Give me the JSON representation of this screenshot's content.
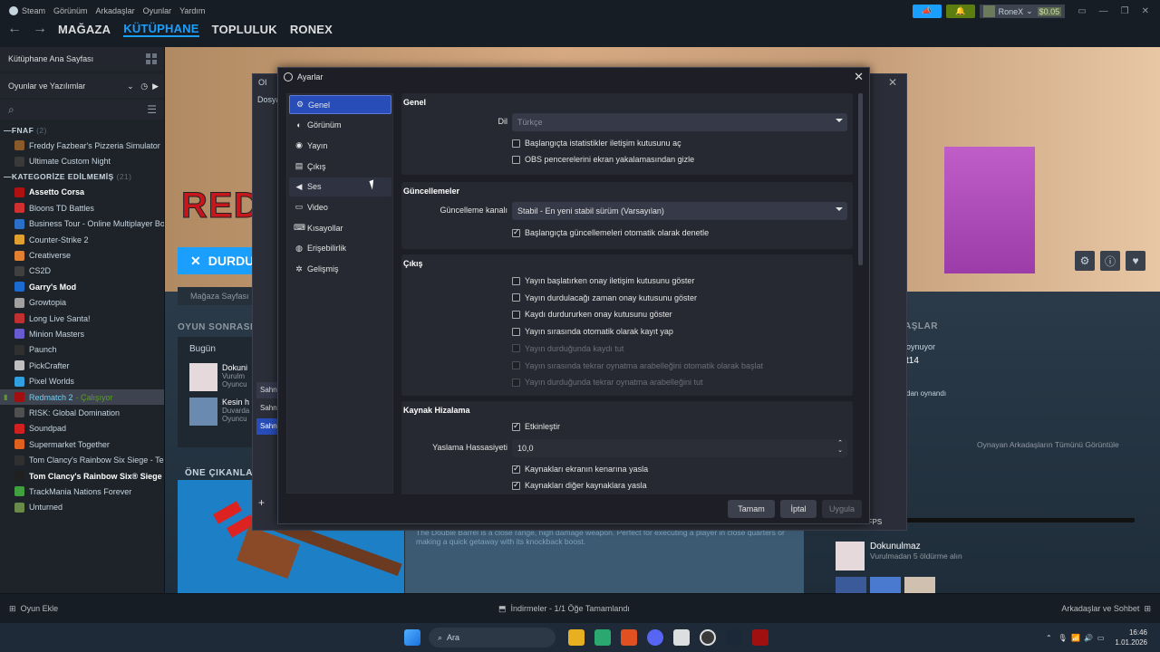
{
  "menubar": {
    "steam": "Steam",
    "items": [
      "Görünüm",
      "Arkadaşlar",
      "Oyunlar",
      "Yardım"
    ]
  },
  "nav": {
    "tabs": [
      "MAĞAZA",
      "KÜTÜPHANE",
      "TOPLULUK",
      "RONEX"
    ],
    "active": "KÜTÜPHANE"
  },
  "user": {
    "name": "RoneX",
    "balance": "$0.05"
  },
  "sidebar": {
    "home": "Kütüphane Ana Sayfası",
    "filter": "Oyunlar ve Yazılımlar",
    "sections": [
      {
        "name": "FNAF",
        "count": "(2)",
        "games": [
          {
            "label": "Freddy Fazbear's Pizzeria Simulator",
            "color": "#8a5a2a"
          },
          {
            "label": "Ultimate Custom Night",
            "color": "#3a3a3a"
          }
        ]
      },
      {
        "name": "KATEGORİZE EDİLMEMİŞ",
        "count": "(21)",
        "games": [
          {
            "label": "Assetto Corsa",
            "color": "#b01010",
            "bold": true
          },
          {
            "label": "Bloons TD Battles",
            "color": "#d03030"
          },
          {
            "label": "Business Tour - Online Multiplayer Bo",
            "color": "#2a70c8"
          },
          {
            "label": "Counter-Strike 2",
            "color": "#e0a030"
          },
          {
            "label": "Creativerse",
            "color": "#e08030"
          },
          {
            "label": "CS2D",
            "color": "#404040"
          },
          {
            "label": "Garry's Mod",
            "color": "#1a6ad0",
            "bold": true
          },
          {
            "label": "Growtopia",
            "color": "#a0a0a0"
          },
          {
            "label": "Long Live Santa!",
            "color": "#c03030"
          },
          {
            "label": "Minion Masters",
            "color": "#6a5ad0"
          },
          {
            "label": "Paunch",
            "color": "#303030"
          },
          {
            "label": "PickCrafter",
            "color": "#c0c0c0"
          },
          {
            "label": "Pixel Worlds",
            "color": "#30a0e0"
          },
          {
            "label": "Redmatch 2",
            "color": "#a01010",
            "running": true,
            "status": "- Çalışıyor"
          },
          {
            "label": "RISK: Global Domination",
            "color": "#505050"
          },
          {
            "label": "Soundpad",
            "color": "#d02020"
          },
          {
            "label": "Supermarket Together",
            "color": "#e06020"
          },
          {
            "label": "Tom Clancy's Rainbow Six Siege - Tes",
            "color": "#303030"
          },
          {
            "label": "Tom Clancy's Rainbow Six® Siege X",
            "color": "#202020",
            "bold": true
          },
          {
            "label": "TrackMania Nations Forever",
            "color": "#40a040"
          },
          {
            "label": "Unturned",
            "color": "#6a8a4a"
          }
        ]
      }
    ]
  },
  "main": {
    "hero_text": "REDI",
    "stop_label": "DURDU",
    "store_page": "Mağaza Sayfası",
    "post_game": "OYUN SONRASI ÖZ",
    "today": "Bugün",
    "ach1_title": "Dokuni",
    "ach1_sub": "Vurulm",
    "ach1_sub2": "Oyuncu",
    "ach2_title": "Kesin h",
    "ach2_sub": "Duvarda",
    "ach2_sub2": "Oyuncu",
    "featured": "ÖNE ÇIKANLAR",
    "featured_desc": "The Double Barrel is a close range, high damage weapon. Perfect for executing a player in close quarters or making a quick getaway with its knockback boost.",
    "friends_heading": "AŞLAR",
    "playing": "oynuyor",
    "player_name": "t14",
    "played": "dan oynandı",
    "all_friends": "Oynayan Arkadaşların Tümünü Görüntüle",
    "ach_title": "Dokunulmaz",
    "ach_sub": "Vurulmadan 5 öldürme alın",
    "fps": "0 FPS"
  },
  "bottombar": {
    "add_game": "Oyun Ekle",
    "downloads": "İndirmeler - 1/1 Öğe Tamamlandı",
    "friends": "Arkadaşlar ve Sohbet"
  },
  "obs_back": {
    "title": "OI",
    "file": "Dosya",
    "scenes_label": "Sahne",
    "scene_a": "Sahne",
    "scene_b": "Sahne"
  },
  "settings": {
    "title": "Ayarlar",
    "nav": [
      "Genel",
      "Görünüm",
      "Yayın",
      "Çıkış",
      "Ses",
      "Video",
      "Kısayollar",
      "Erişebilirlik",
      "Gelişmiş"
    ],
    "nav_icons": [
      "⚙",
      "◐",
      "◉",
      "▤",
      "◀",
      "▭",
      "⌨",
      "◍",
      "✲"
    ],
    "general": {
      "heading": "Genel",
      "lang_label": "Dil",
      "lang_value": "Türkçe",
      "cb1": "Başlangıçta istatistikler iletişim kutusunu aç",
      "cb2": "OBS pencerelerini ekran yakalamasından gizle"
    },
    "updates": {
      "heading": "Güncellemeler",
      "channel_label": "Güncelleme kanalı",
      "channel_value": "Stabil - En yeni stabil sürüm (Varsayılan)",
      "cb1": "Başlangıçta güncellemeleri otomatik olarak denetle"
    },
    "output": {
      "heading": "Çıkış",
      "items": [
        {
          "label": "Yayın başlatırken onay iletişim kutusunu göster",
          "on": false,
          "dis": false
        },
        {
          "label": "Yayın durdulacağı zaman onay kutusunu göster",
          "on": false,
          "dis": false
        },
        {
          "label": "Kaydı durdururken onay kutusunu göster",
          "on": false,
          "dis": false
        },
        {
          "label": "Yayın sırasında otomatik olarak kayıt yap",
          "on": false,
          "dis": false
        },
        {
          "label": "Yayın durduğunda kaydı tut",
          "on": false,
          "dis": true
        },
        {
          "label": "Yayın sırasında tekrar oynatma arabelleğini otomatik olarak başlat",
          "on": false,
          "dis": true
        },
        {
          "label": "Yayın durduğunda tekrar oynatma arabelleğini tut",
          "on": false,
          "dis": true
        }
      ]
    },
    "snap": {
      "heading": "Kaynak Hizalama",
      "enable": "Etkinleştir",
      "sens_label": "Yaslama Hassasiyeti",
      "sens_value": "10,0",
      "cb1": "Kaynakları ekranın kenarına yasla",
      "cb2": "Kaynakları diğer kaynaklara yasla"
    },
    "buttons": {
      "ok": "Tamam",
      "cancel": "İptal",
      "apply": "Uygula"
    }
  },
  "taskbar": {
    "search": "Ara",
    "time": "16:46",
    "date": "1.01.2026"
  }
}
